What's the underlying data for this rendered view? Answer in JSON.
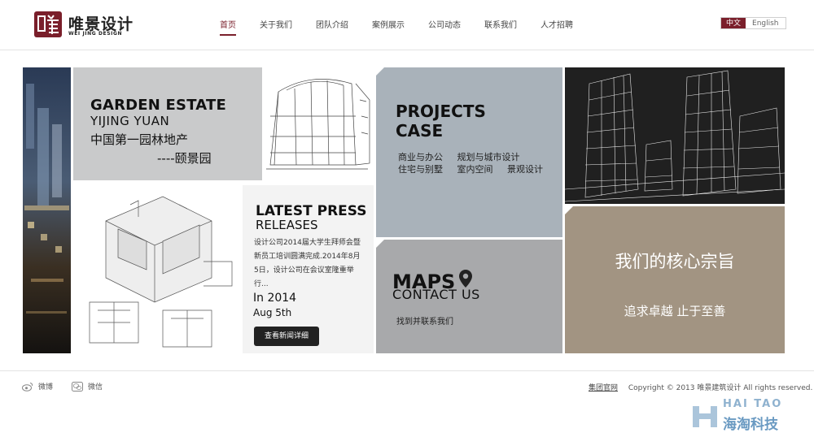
{
  "brand": {
    "name_cn": "唯景设计",
    "name_en": "WEI JING DESIGN",
    "color": "#7a1f2b"
  },
  "nav": [
    {
      "label": "首页",
      "active": true
    },
    {
      "label": "关于我们",
      "active": false
    },
    {
      "label": "团队介绍",
      "active": false
    },
    {
      "label": "案例展示",
      "active": false
    },
    {
      "label": "公司动态",
      "active": false
    },
    {
      "label": "联系我们",
      "active": false
    },
    {
      "label": "人才招聘",
      "active": false
    }
  ],
  "language": {
    "cn": "中文",
    "en": "English",
    "selected": "中文"
  },
  "garden": {
    "title": "GARDEN ESTATE",
    "subtitle": "YIJING YUAN",
    "cn_line1": "中国第一园林地产",
    "cn_line2": "----颐景园"
  },
  "press": {
    "title_line1": "LATEST PRESS",
    "title_line2": "RELEASES",
    "body": "设计公司2014届大学生拜师会暨新员工培训圆满完成.2014年8月5日，设计公司在会议室隆重举行...",
    "year": "In 2014",
    "date": "Aug 5th",
    "button": "查看新闻详细"
  },
  "projects": {
    "title_line1": "PROJECTS",
    "title_line2": "CASE",
    "row1": [
      "商业与办公",
      "规划与城市设计"
    ],
    "row2": [
      "住宅与别墅",
      "室内空间",
      "景观设计"
    ]
  },
  "maps": {
    "title_line1": "MAPS",
    "title_line2": "CONTACT US",
    "link": "找到并联系我们"
  },
  "core": {
    "title": "我们的核心宗旨",
    "subtitle": "追求卓越 止于至善"
  },
  "footer": {
    "weibo": "微博",
    "wechat": "微信",
    "group_link": "集团官网",
    "copyright": "Copyright © 2013 唯景建筑设计   All rights reserved."
  },
  "watermark": {
    "en": "HAI TAO",
    "cn": "海淘科技"
  }
}
